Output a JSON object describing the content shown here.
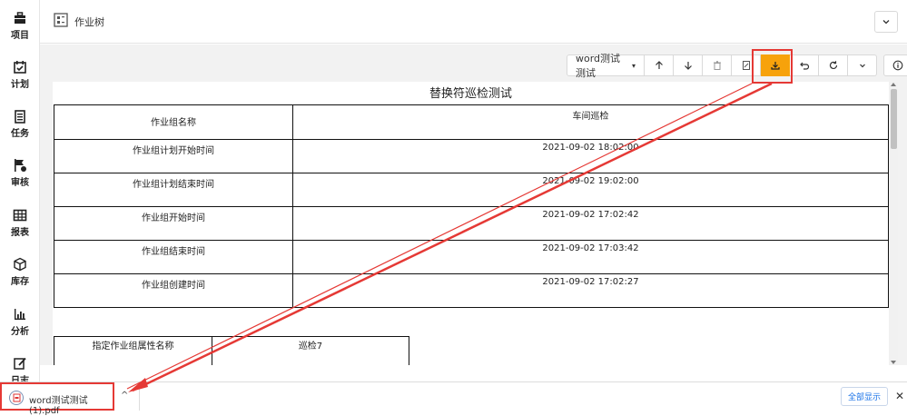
{
  "sidebar": {
    "items": [
      {
        "label": "项目",
        "icon": "briefcase-icon"
      },
      {
        "label": "计划",
        "icon": "calendar-icon"
      },
      {
        "label": "任务",
        "icon": "clipboard-icon"
      },
      {
        "label": "审核",
        "icon": "flag-icon"
      },
      {
        "label": "报表",
        "icon": "table-icon"
      },
      {
        "label": "库存",
        "icon": "box-icon"
      },
      {
        "label": "分析",
        "icon": "bar-chart-icon"
      },
      {
        "label": "日志",
        "icon": "edit-icon"
      }
    ]
  },
  "header": {
    "title": "作业树"
  },
  "toolbar": {
    "template_select": "word测试测试",
    "buttons": [
      "arrow-up-icon",
      "arrow-down-icon",
      "trash-icon",
      "file-icon",
      "download-icon",
      "undo-icon",
      "refresh-icon",
      "chevron-down-icon",
      "info-icon"
    ],
    "accent": "#f7a20b"
  },
  "document": {
    "title": "替换符巡检测试",
    "table1": {
      "header": [
        "作业组名称",
        "车间巡检"
      ],
      "rows": [
        [
          "作业组计划开始时间",
          "2021-09-02 18:02:00"
        ],
        [
          "作业组计划结束时间",
          "2021-09-02 19:02:00"
        ],
        [
          "作业组开始时间",
          "2021-09-02 17:02:42"
        ],
        [
          "作业组结束时间",
          "2021-09-02 17:03:42"
        ],
        [
          "作业组创建时间",
          "2021-09-02 17:02:27"
        ]
      ]
    },
    "table2": {
      "rows": [
        [
          "指定作业组属性名称",
          "巡检7"
        ]
      ]
    }
  },
  "download_bar": {
    "file_name": "word测试测试 (1).pdf",
    "show_all": "全部显示",
    "close": "✕"
  },
  "annotation_color": "#e53935"
}
